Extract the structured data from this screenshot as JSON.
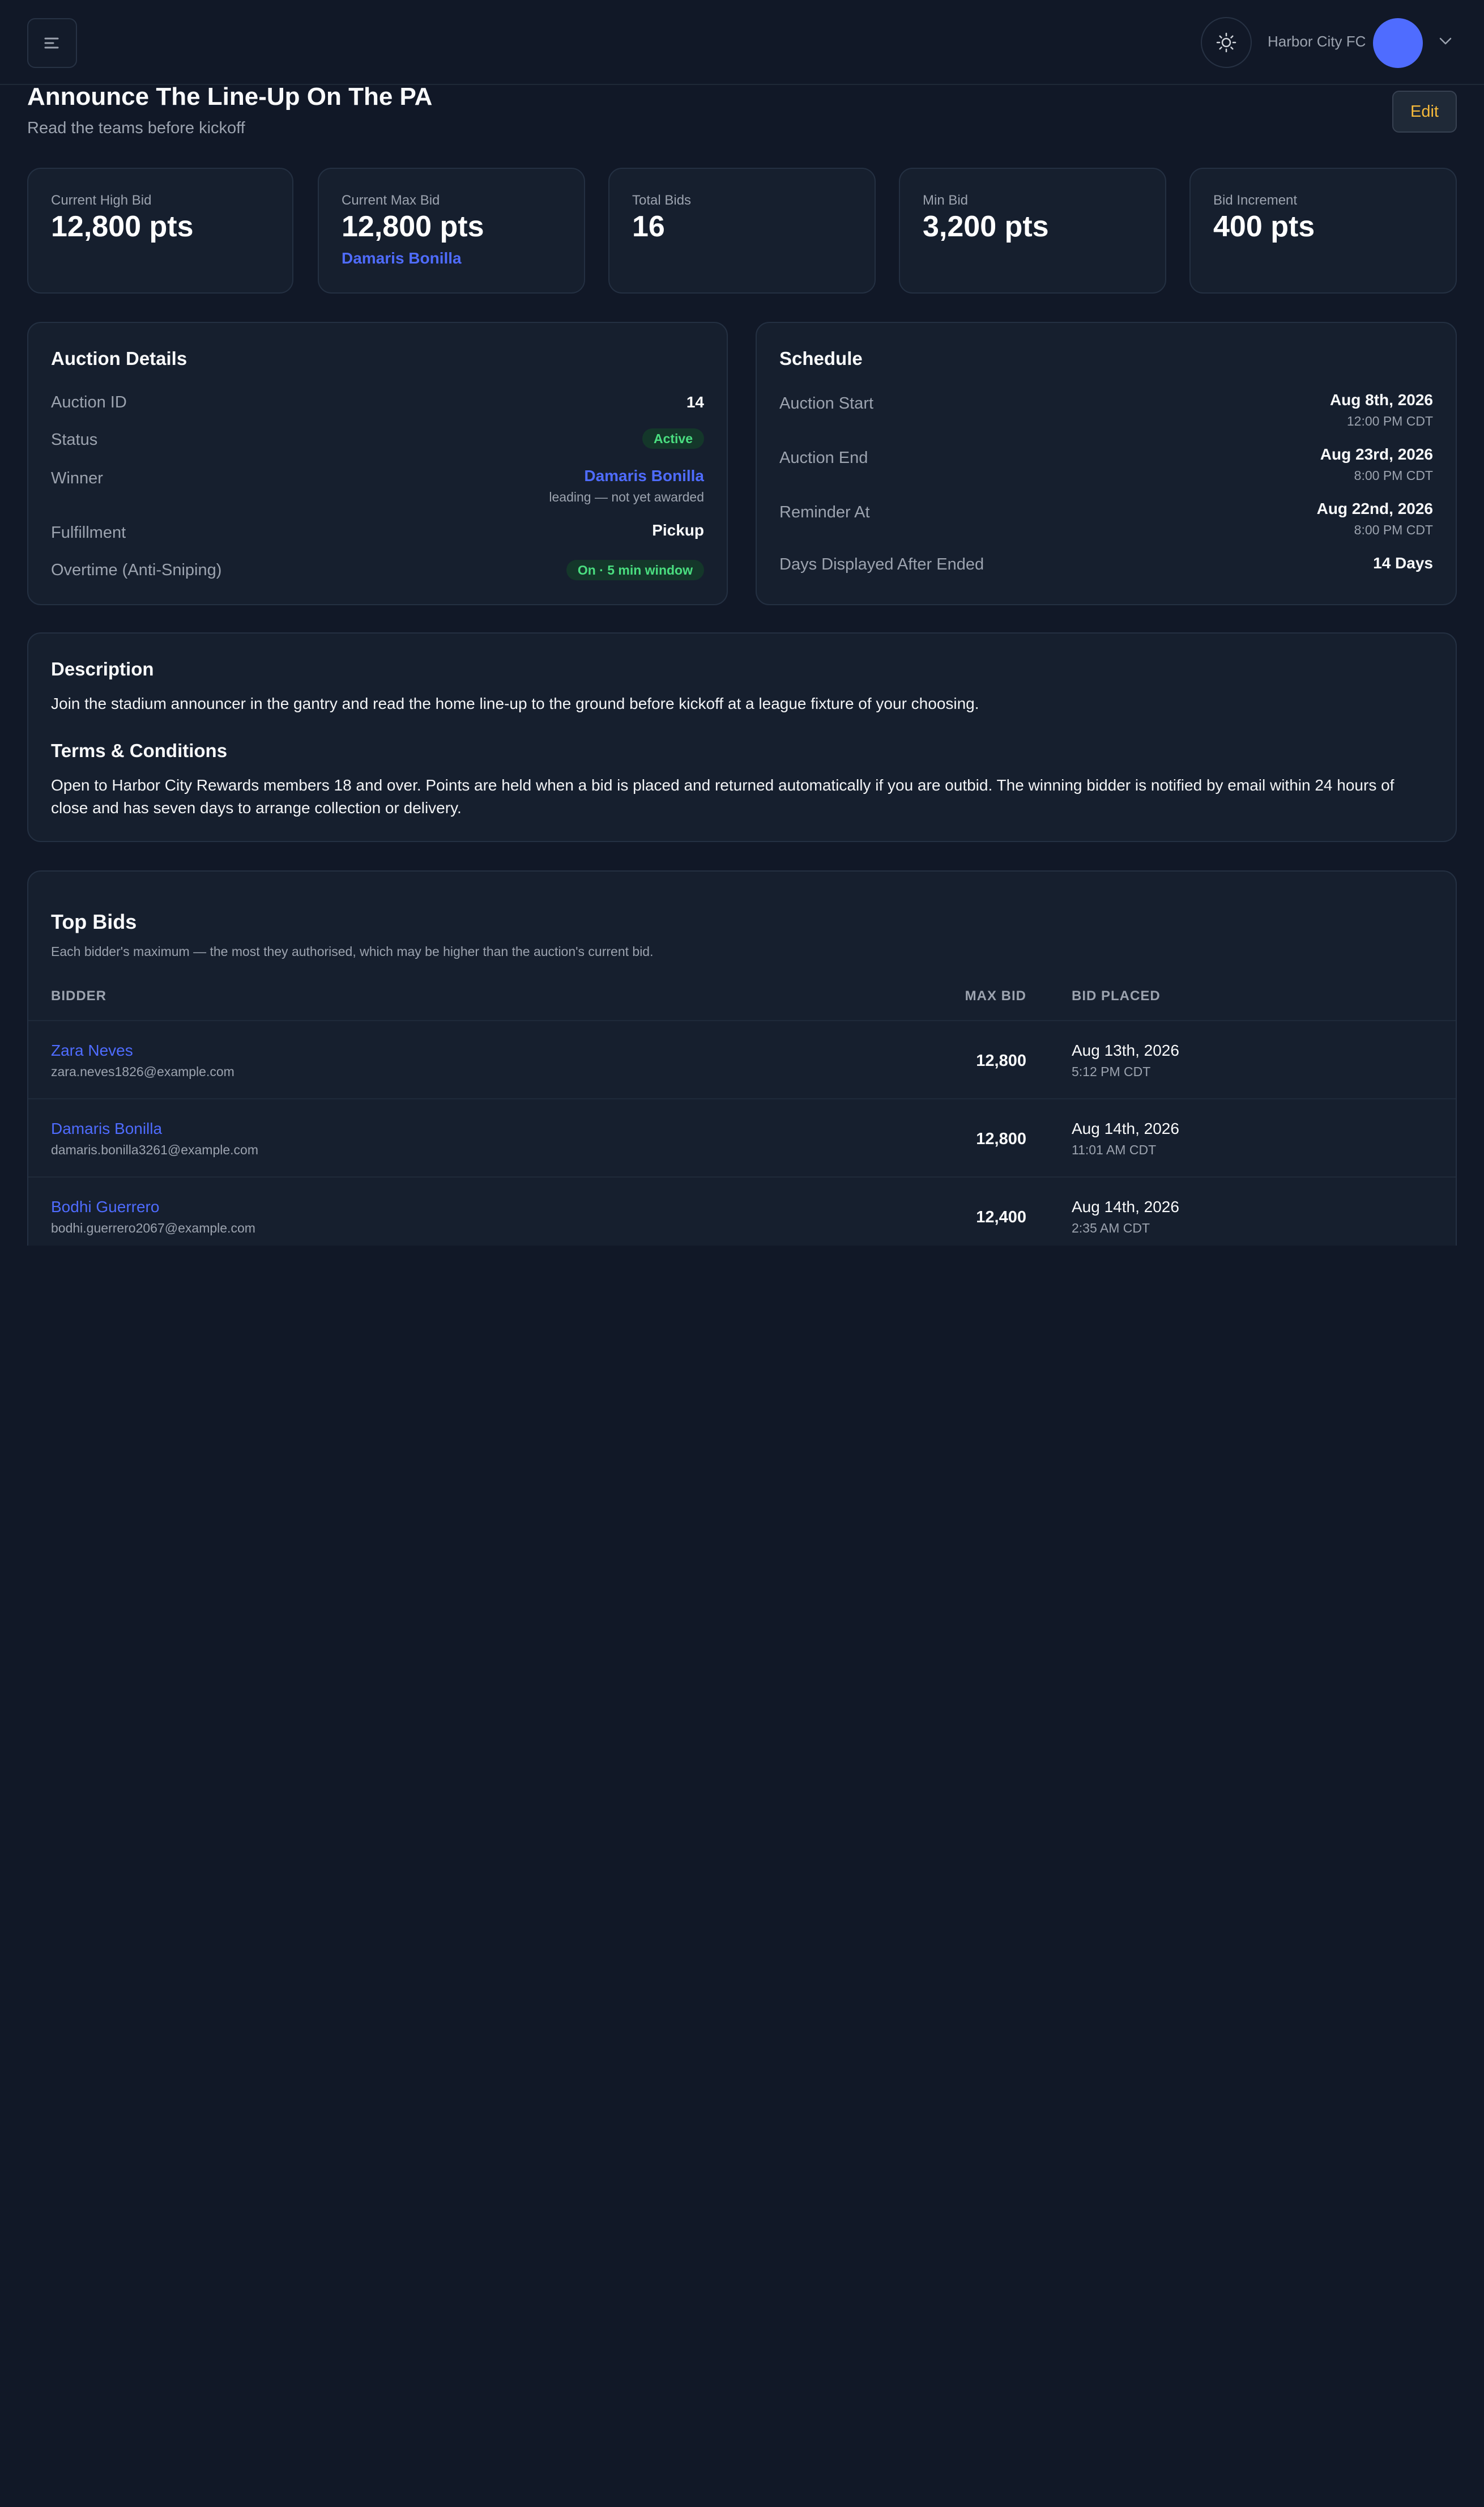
{
  "header": {
    "org_name": "Harbor City FC",
    "icons": [
      "menu-icon",
      "sun-icon",
      "chevron-down-icon"
    ]
  },
  "page": {
    "title": "Announce The Line-Up On The PA",
    "subtitle": "Read the teams before kickoff",
    "edit_label": "Edit"
  },
  "stats": [
    {
      "label": "Current High Bid",
      "value": "12,800 pts"
    },
    {
      "label": "Current Max Bid",
      "value": "12,800 pts",
      "extra": "Damaris Bonilla"
    },
    {
      "label": "Total Bids",
      "value": "16"
    },
    {
      "label": "Min Bid",
      "value": "3,200 pts"
    },
    {
      "label": "Bid Increment",
      "value": "400 pts"
    }
  ],
  "details": {
    "title": "Auction Details",
    "rows": [
      {
        "label": "Auction ID",
        "value": "14"
      },
      {
        "label": "Status",
        "value": "Active"
      },
      {
        "label": "Winner",
        "value": "Damaris Bonilla",
        "sub": "leading — not yet awarded"
      },
      {
        "label": "Fulfillment",
        "value": "Pickup"
      },
      {
        "label": "Overtime (Anti-Sniping)",
        "value": "On · 5 min window"
      }
    ]
  },
  "schedule": {
    "title": "Schedule",
    "rows": [
      {
        "label": "Auction Start",
        "value": "Aug 8th, 2026",
        "sub": "12:00 PM CDT"
      },
      {
        "label": "Auction End",
        "value": "Aug 23rd, 2026",
        "sub": "8:00 PM CDT"
      },
      {
        "label": "Reminder At",
        "value": "Aug 22nd, 2026",
        "sub": "8:00 PM CDT"
      },
      {
        "label": "Days Displayed After Ended",
        "value": "14 Days"
      }
    ]
  },
  "description": {
    "title": "Description",
    "text": "Join the stadium announcer in the gantry and read the home line-up to the ground before kickoff at a league fixture of your choosing.",
    "terms_title": "Terms & Conditions",
    "terms_text": "Open to Harbor City Rewards members 18 and over. Points are held when a bid is placed and returned automatically if you are outbid. The winning bidder is notified by email within 24 hours of close and has seven days to arrange collection or delivery."
  },
  "top_bids": {
    "title": "Top Bids",
    "subtitle": "Each bidder's maximum — the most they authorised, which may be higher than the auction's current bid.",
    "columns": [
      "BIDDER",
      "MAX BID",
      "BID PLACED"
    ],
    "rows": [
      {
        "name": "Zara Neves",
        "email": "zara.neves1826@example.com",
        "max_bid": "12,800",
        "date": "Aug 13th, 2026",
        "time": "5:12 PM CDT"
      },
      {
        "name": "Damaris Bonilla",
        "email": "damaris.bonilla3261@example.com",
        "max_bid": "12,800",
        "date": "Aug 14th, 2026",
        "time": "11:01 AM CDT"
      },
      {
        "name": "Bodhi Guerrero",
        "email": "bodhi.guerrero2067@example.com",
        "max_bid": "12,400",
        "date": "Aug 14th, 2026",
        "time": "2:35 AM CDT"
      }
    ]
  }
}
